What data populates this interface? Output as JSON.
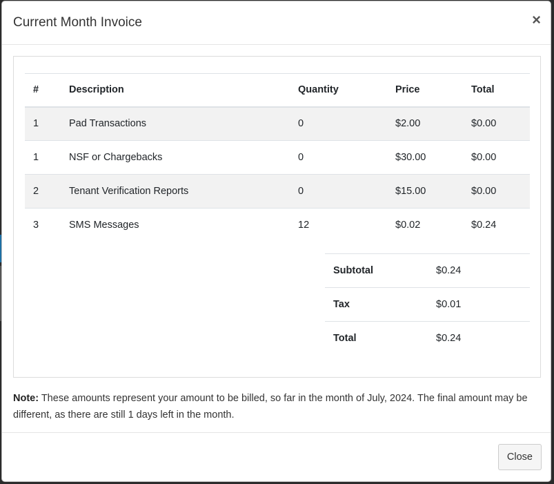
{
  "modal": {
    "title": "Current Month Invoice",
    "close_icon": "×",
    "close_button_label": "Close"
  },
  "table": {
    "headers": [
      "#",
      "Description",
      "Quantity",
      "Price",
      "Total"
    ],
    "rows": [
      {
        "num": "1",
        "description": "Pad Transactions",
        "quantity": "0",
        "price": "$2.00",
        "total": "$0.00"
      },
      {
        "num": "1",
        "description": "NSF or Chargebacks",
        "quantity": "0",
        "price": "$30.00",
        "total": "$0.00"
      },
      {
        "num": "2",
        "description": "Tenant Verification Reports",
        "quantity": "0",
        "price": "$15.00",
        "total": "$0.00"
      },
      {
        "num": "3",
        "description": "SMS Messages",
        "quantity": "12",
        "price": "$0.02",
        "total": "$0.24"
      }
    ]
  },
  "summary": {
    "subtotal_label": "Subtotal",
    "subtotal_value": "$0.24",
    "tax_label": "Tax",
    "tax_value": "$0.01",
    "total_label": "Total",
    "total_value": "$0.24"
  },
  "note": {
    "label": "Note:",
    "text": " These amounts represent your amount to be billed, so far in the month of July, 2024. The final amount may be different, as there are still 1 days left in the month."
  }
}
